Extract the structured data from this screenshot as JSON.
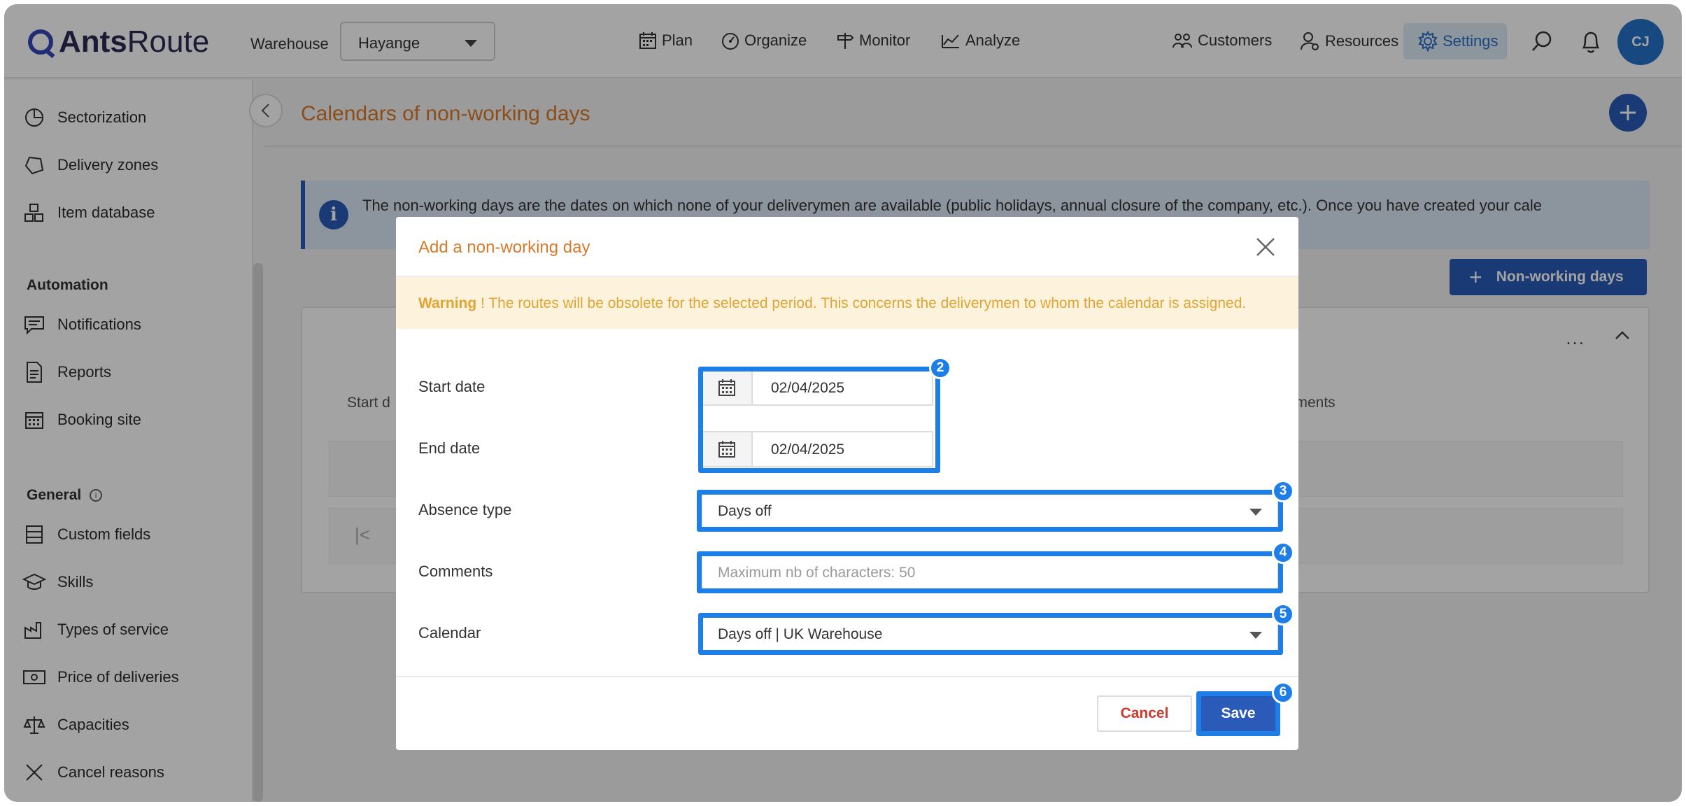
{
  "header": {
    "logo_bold": "Ants",
    "logo_light": "Route",
    "warehouse_label": "Warehouse",
    "warehouse_value": "Hayange",
    "nav": [
      "Plan",
      "Organize",
      "Monitor",
      "Analyze"
    ],
    "right_nav": [
      "Customers",
      "Resources",
      "Settings"
    ],
    "avatar_initials": "CJ"
  },
  "sidebar": {
    "items_top": [
      "Sectorization",
      "Delivery zones",
      "Item database"
    ],
    "automation_heading": "Automation",
    "automation_items": [
      "Notifications",
      "Reports",
      "Booking site"
    ],
    "general_heading": "General",
    "general_items": [
      "Custom fields",
      "Skills",
      "Types of service",
      "Price of deliveries",
      "Capacities",
      "Cancel reasons"
    ]
  },
  "main": {
    "title": "Calendars of non-working days",
    "info_text": "The non-working days are the dates on which none of your deliverymen are available (public holidays, annual closure of the company, etc.). Once you have created your cale",
    "nonworking_button": "Non-working days",
    "col_start": "Start d",
    "col_comments": "mments",
    "more_label": "..."
  },
  "modal": {
    "title": "Add a non-working day",
    "warning_bold": "Warning",
    "warning_text": " ! The routes will be obsolete for the selected period. This concerns the deliverymen to whom the calendar is assigned.",
    "start_label": "Start date",
    "start_value": "02/04/2025",
    "end_label": "End date",
    "end_value": "02/04/2025",
    "absence_label": "Absence type",
    "absence_value": "Days off",
    "comments_label": "Comments",
    "comments_placeholder": "Maximum nb of characters: 50",
    "calendar_label": "Calendar",
    "calendar_value": "Days off | UK Warehouse",
    "cancel": "Cancel",
    "save": "Save"
  },
  "annotations": [
    "2",
    "3",
    "4",
    "5",
    "6"
  ],
  "colors": {
    "accent": "#2a5bb8",
    "title_orange": "#d97a2b",
    "highlight": "#1e7ee8",
    "warning_text": "#e0a432"
  }
}
